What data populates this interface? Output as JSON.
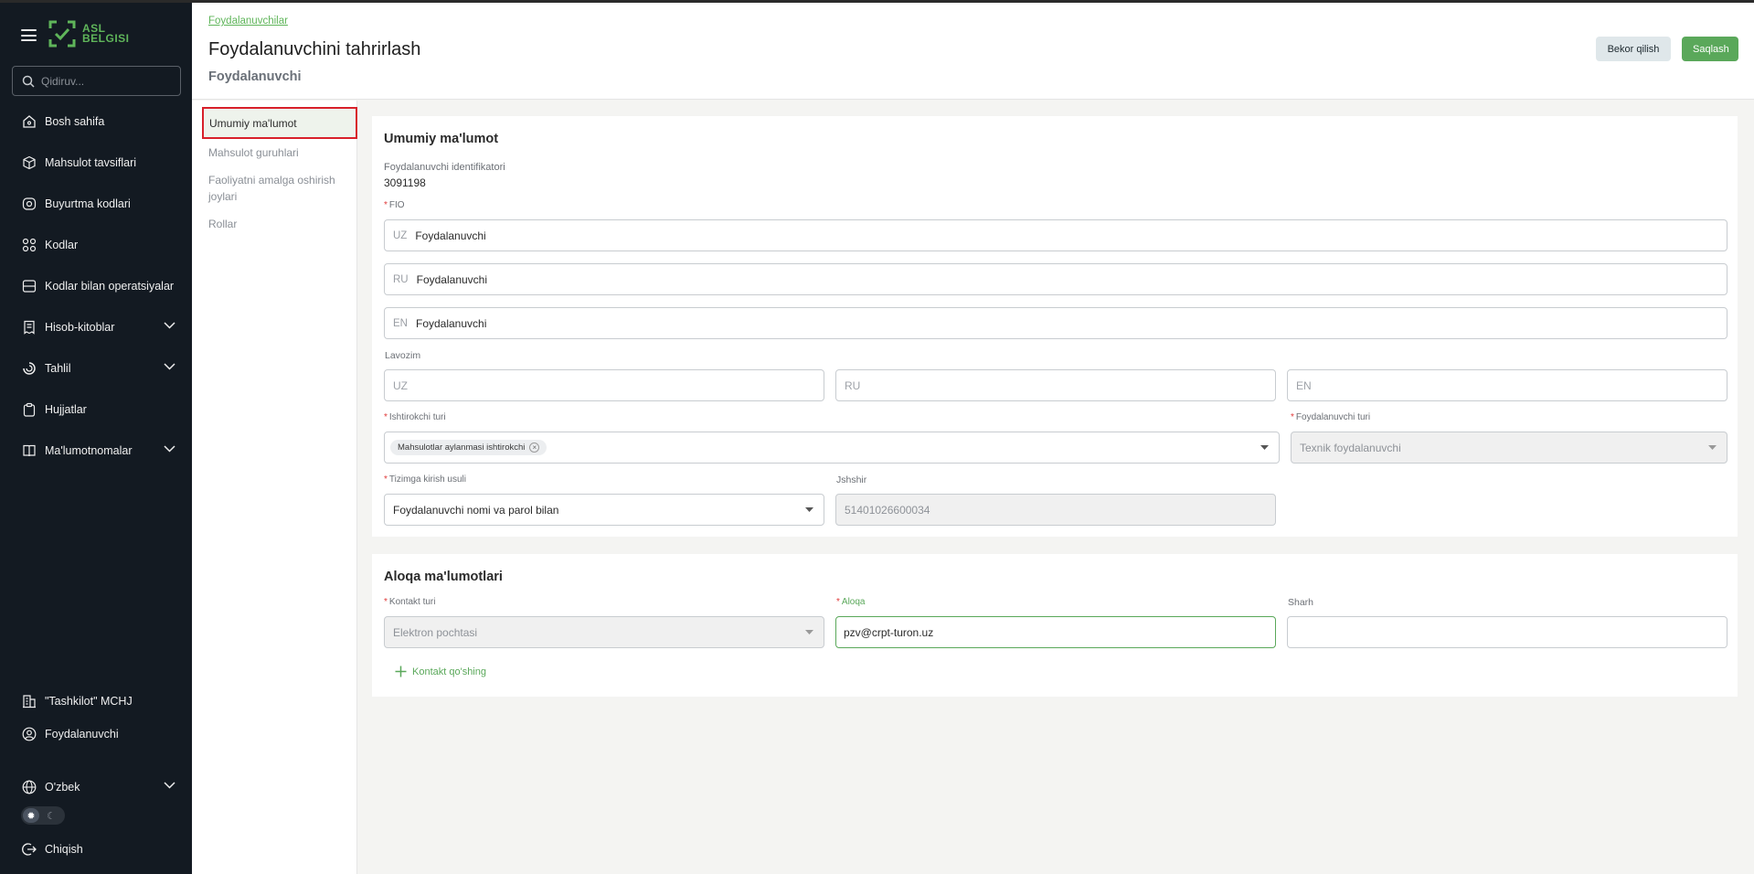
{
  "brand": {
    "logo_text_1": "ASL",
    "logo_text_2": "BELGISI",
    "accent": "#5aa85a"
  },
  "search": {
    "placeholder": "Qidiruv..."
  },
  "sidebar": {
    "items": [
      {
        "label": "Bosh sahifa",
        "icon": "home-icon"
      },
      {
        "label": "Mahsulot tavsiflari",
        "icon": "cube-icon"
      },
      {
        "label": "Buyurtma kodlari",
        "icon": "code-order-icon"
      },
      {
        "label": "Kodlar",
        "icon": "qr-codes-icon"
      },
      {
        "label": "Kodlar bilan operatsiyalar",
        "icon": "operations-icon"
      },
      {
        "label": "Hisob-kitoblar",
        "icon": "receipt-icon"
      },
      {
        "label": "Tahlil",
        "icon": "analytics-icon"
      },
      {
        "label": "Hujjatlar",
        "icon": "clipboard-icon"
      },
      {
        "label": "Ma'lumotnomalar",
        "icon": "book-icon"
      }
    ],
    "organization": "\"Tashkilot\" MCHJ",
    "user": "Foydalanuvchi",
    "language": "O'zbek",
    "logout": "Chiqish"
  },
  "header": {
    "breadcrumb": "Foydalanuvchilar",
    "title": "Foydalanuvchini tahrirlash",
    "subtitle": "Foydalanuvchi",
    "cancel_label": "Bekor qilish",
    "save_label": "Saqlash"
  },
  "section_nav": {
    "items": [
      "Umumiy ma'lumot",
      "Mahsulot guruhlari",
      "Faoliyatni amalga oshirish joylari",
      "Rollar"
    ],
    "active": "Umumiy ma'lumot"
  },
  "general": {
    "title": "Umumiy ma'lumot",
    "id_label": "Foydalanuvchi identifikatori",
    "id_value": "3091198",
    "fio_label": "FIO",
    "fio": [
      {
        "lang": "UZ",
        "value": "Foydalanuvchi"
      },
      {
        "lang": "RU",
        "value": "Foydalanuvchi"
      },
      {
        "lang": "EN",
        "value": "Foydalanuvchi"
      }
    ],
    "position_label": "Lavozim",
    "position_placeholders": [
      "UZ",
      "RU",
      "EN"
    ],
    "participant_type_label": "Ishtirokchi turi",
    "participant_type_chip": "Mahsulotlar aylanmasi ishtirokchi",
    "user_type_label": "Foydalanuvchi turi",
    "user_type_value": "Texnik foydalanuvchi",
    "login_method_label": "Tizimga kirish usuli",
    "login_method_value": "Foydalanuvchi nomi va parol bilan",
    "pinfl_label": "Jshshir",
    "pinfl_value": "51401026600034"
  },
  "contacts": {
    "title": "Aloqa ma'lumotlari",
    "contact_type_label": "Kontakt turi",
    "contact_type_value": "Elektron pochtasi",
    "contact_label": "Aloqa",
    "contact_value": "pzv@crpt-turon.uz",
    "comment_label": "Sharh",
    "add_label": "Kontakt qo'shing"
  }
}
